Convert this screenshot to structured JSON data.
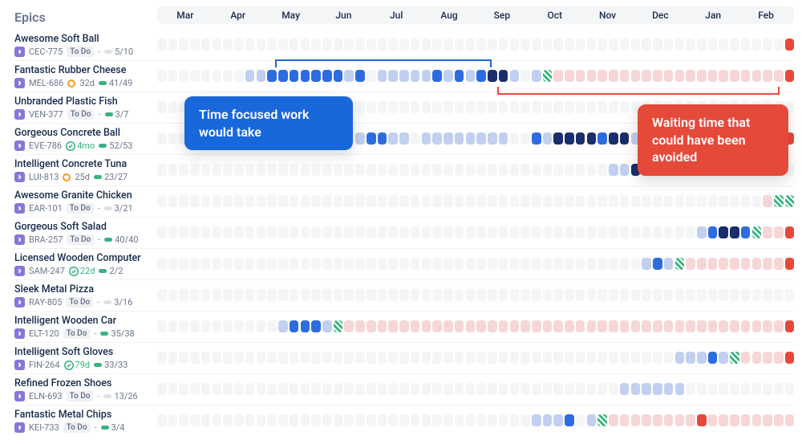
{
  "sidebar_title": "Epics",
  "months": [
    "Mar",
    "Apr",
    "May",
    "Jun",
    "Jul",
    "Aug",
    "Sep",
    "Oct",
    "Nov",
    "Dec",
    "Jan",
    "Feb"
  ],
  "callouts": {
    "focused_work": "Time focused work would take",
    "waiting_time": "Waiting time that could have been avoided"
  },
  "status_labels": {
    "todo": "To Do"
  },
  "epics": [
    {
      "name": "Awesome Soft Ball",
      "key": "CEC-775",
      "status": "To Do",
      "status_type": "todo",
      "progress_done": 5,
      "progress_total": 10,
      "progress_color": "gray",
      "cells": "eeeeeeeeeeeeeeeeeeeeeeeeeeeeeeeeeeeeeeeeeeeeeeeeeeeeeeeeeR"
    },
    {
      "name": "Fantastic Rubber Cheese",
      "key": "MEL-686",
      "status": "32d",
      "status_type": "orange",
      "progress_done": 41,
      "progress_total": 49,
      "progress_color": "green",
      "cells": "eeeeeeeellbbbbbbblbelllllblblbddlelGrrrrrrrrrrrrrrrrrrrrrR"
    },
    {
      "name": "Unbranded Plastic Fish",
      "key": "VEN-377",
      "status": "To Do",
      "status_type": "todo",
      "progress_done": 3,
      "progress_total": 7,
      "progress_color": "green",
      "cells": "eeeeeeeeeeeeeeeeeeeeeeeeeeeeeeeeeeeeeeeeeeeeeeeeeeeeeeeeee"
    },
    {
      "name": "Gorgeous Concrete Ball",
      "key": "EVE-786",
      "status": "4mo",
      "status_type": "done",
      "progress_done": 52,
      "progress_total": 53,
      "progress_color": "green",
      "cells": "eeeeeeeeeeeeeeeeeelbbllelllllllleeblddddbddlGrrrrrrrrrrrrR"
    },
    {
      "name": "Intelligent Concrete Tuna",
      "key": "LUI-813",
      "status": "25d",
      "status_type": "orange",
      "progress_done": 23,
      "progress_total": 27,
      "progress_color": "green",
      "cells": "eeeeeeeeeeeeeeeeeeeeeeeeeeeeeeeeeeeeeeeeellddbbbleeeeeeeee"
    },
    {
      "name": "Awesome Granite Chicken",
      "key": "EAR-101",
      "status": "To Do",
      "status_type": "todo",
      "progress_done": 3,
      "progress_total": 21,
      "progress_color": "gray",
      "cells": "eeeeeeeeeeeeeeeeeeeeeeeeeeeeeeeeeeeeeeeeeeeeeeeeeeeeeeerGG"
    },
    {
      "name": "Gorgeous Soft Salad",
      "key": "BRA-257",
      "status": "To Do",
      "status_type": "todo",
      "progress_done": 40,
      "progress_total": 40,
      "progress_color": "green",
      "cells": "eeeeeeeeeeeeeeeeeeeeeeeeeeeeeeeeeeeeeeeeeeeeeeeeelbddbGrrR"
    },
    {
      "name": "Licensed Wooden Computer",
      "key": "SAM-247",
      "status": "22d",
      "status_type": "done",
      "progress_done": 2,
      "progress_total": 2,
      "progress_color": "green",
      "cells": "eeeeeeeeeeeeeeeeeeeeeeeeeeeeeeeeeeeeeeeeeeeelblGrrrrrrrrrR"
    },
    {
      "name": "Sleek Metal Pizza",
      "key": "RAY-805",
      "status": "To Do",
      "status_type": "todo",
      "progress_done": 3,
      "progress_total": 16,
      "progress_color": "gray",
      "cells": "eeeeeeeeeeeeeeeeeeeeeeeeeeeeeeeeeeeeeeeeeeeeeeeeeeeeeeeeee"
    },
    {
      "name": "Intelligent Wooden Car",
      "key": "ELT-120",
      "status": "To Do",
      "status_type": "todo",
      "progress_done": 35,
      "progress_total": 38,
      "progress_color": "green",
      "cells": "eeeeeeeeeeelbbblGrrrrrrrrrrrrrrrrrrrrrrrrrrrrrrrrrrrrrrrrR"
    },
    {
      "name": "Intelligent Soft Gloves",
      "key": "FIN-264",
      "status": "79d",
      "status_type": "done",
      "progress_done": 33,
      "progress_total": 33,
      "progress_color": "green",
      "cells": "eeeeeeeeeeeeeeeeeeeeeeeeeeeeeeeeeeeeeeeeeeeeeeelllblGrrrrR"
    },
    {
      "name": "Refined Frozen Shoes",
      "key": "ELN-693",
      "status": "To Do",
      "status_type": "todo",
      "progress_done": 13,
      "progress_total": 26,
      "progress_color": "gray",
      "cells": "eeeeeeeeeeeeeeeeeeeeeeeeeeeeeeeeeeeeeeeeeelllllleeeeeeeeee"
    },
    {
      "name": "Fantastic Metal Chips",
      "key": "KEI-733",
      "status": "To Do",
      "status_type": "todo",
      "progress_done": 3,
      "progress_total": 4,
      "progress_color": "green",
      "cells": "eeeeeeeeeeeeeeeeeeeeeeeeeeeeeeeeeelllbelGrrrrrrrrRrrrrrrrr"
    }
  ]
}
